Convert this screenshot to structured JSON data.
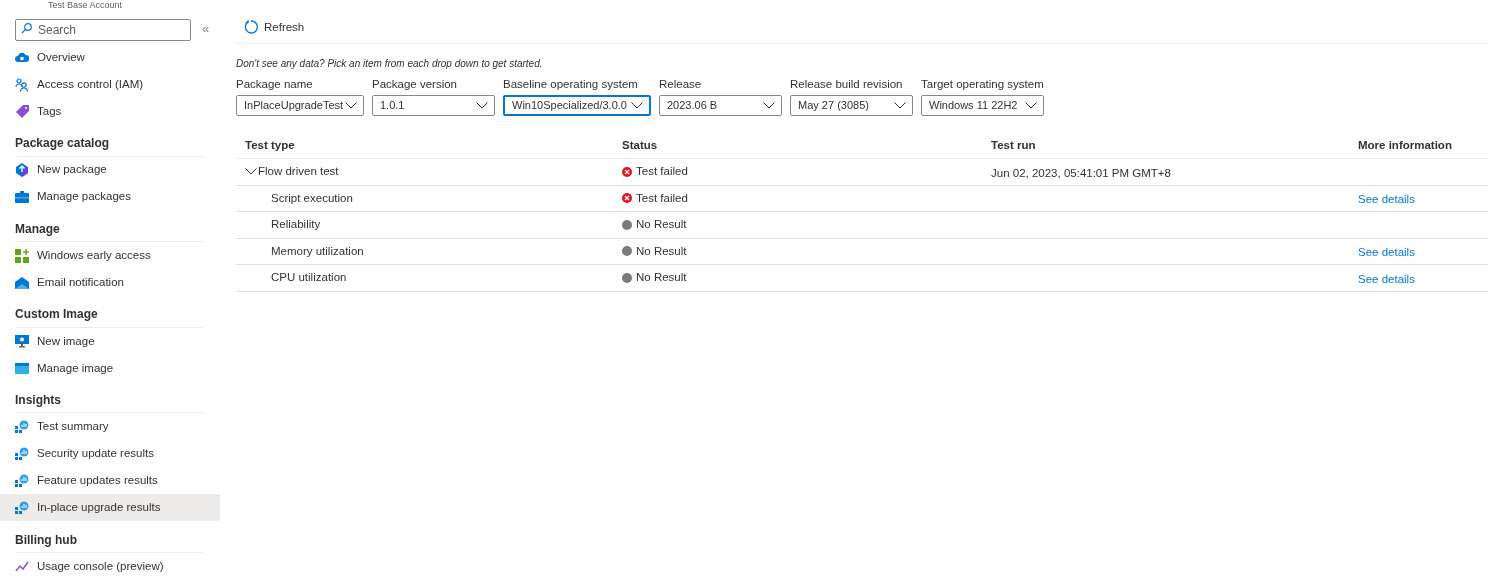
{
  "sidebar": {
    "account_label": "Test Base Account",
    "search": {
      "placeholder": "Search"
    },
    "collapse": "«",
    "groups": [
      {
        "items": [
          {
            "label": "Overview",
            "kind": "cloud",
            "selected": false
          },
          {
            "label": "Access control (IAM)",
            "kind": "people",
            "selected": false
          },
          {
            "label": "Tags",
            "kind": "tag",
            "selected": false
          }
        ]
      },
      {
        "title": "Package catalog",
        "items": [
          {
            "label": "New package",
            "kind": "upload",
            "selected": false
          },
          {
            "label": "Manage packages",
            "kind": "briefcase",
            "selected": false
          }
        ]
      },
      {
        "title": "Manage",
        "items": [
          {
            "label": "Windows early access",
            "kind": "grid",
            "selected": false
          },
          {
            "label": "Email notification",
            "kind": "mail",
            "selected": false
          }
        ]
      },
      {
        "title": "Custom Image",
        "items": [
          {
            "label": "New image",
            "kind": "monitor",
            "selected": false
          },
          {
            "label": "Manage image",
            "kind": "window",
            "selected": false
          }
        ]
      },
      {
        "title": "Insights",
        "items": [
          {
            "label": "Test summary",
            "kind": "insight",
            "selected": false
          },
          {
            "label": "Security update results",
            "kind": "insight",
            "selected": false
          },
          {
            "label": "Feature updates results",
            "kind": "insight",
            "selected": false
          },
          {
            "label": "In-place upgrade results",
            "kind": "insight",
            "selected": true
          }
        ]
      },
      {
        "title": "Billing hub",
        "items": [
          {
            "label": "Usage console (preview)",
            "kind": "usage",
            "selected": false
          }
        ]
      }
    ]
  },
  "toolbar": {
    "refresh": "Refresh"
  },
  "hint": "Don't see any data? Pick an item from each drop down to get started.",
  "filters": [
    {
      "label": "Package name",
      "value": "InPlaceUpgradeTest",
      "focused": false
    },
    {
      "label": "Package version",
      "value": "1.0.1",
      "focused": false
    },
    {
      "label": "Baseline operating system",
      "value": "Win10Specialized/3.0.0",
      "focused": true
    },
    {
      "label": "Release",
      "value": "2023.06 B",
      "focused": false
    },
    {
      "label": "Release build revision",
      "value": "May 27 (3085)",
      "focused": false
    },
    {
      "label": "Target operating system",
      "value": "Windows 11 22H2",
      "focused": false
    }
  ],
  "table": {
    "columns": [
      "Test type",
      "Status",
      "Test run",
      "More information"
    ],
    "rows": [
      {
        "test_type": "Flow driven test",
        "expanded": true,
        "status": {
          "kind": "failed",
          "text": "Test failed"
        },
        "test_run": "Jun 02, 2023, 05:41:01 PM GMT+8",
        "children": [
          {
            "test_type": "Script execution",
            "status": {
              "kind": "failed",
              "text": "Test failed"
            },
            "more": "See details"
          },
          {
            "test_type": "Reliability",
            "status": {
              "kind": "none",
              "text": "No Result"
            }
          },
          {
            "test_type": "Memory utilization",
            "status": {
              "kind": "none",
              "text": "No Result"
            },
            "more": "See details"
          },
          {
            "test_type": "CPU utilization",
            "status": {
              "kind": "none",
              "text": "No Result"
            },
            "more": "See details"
          }
        ]
      }
    ]
  }
}
